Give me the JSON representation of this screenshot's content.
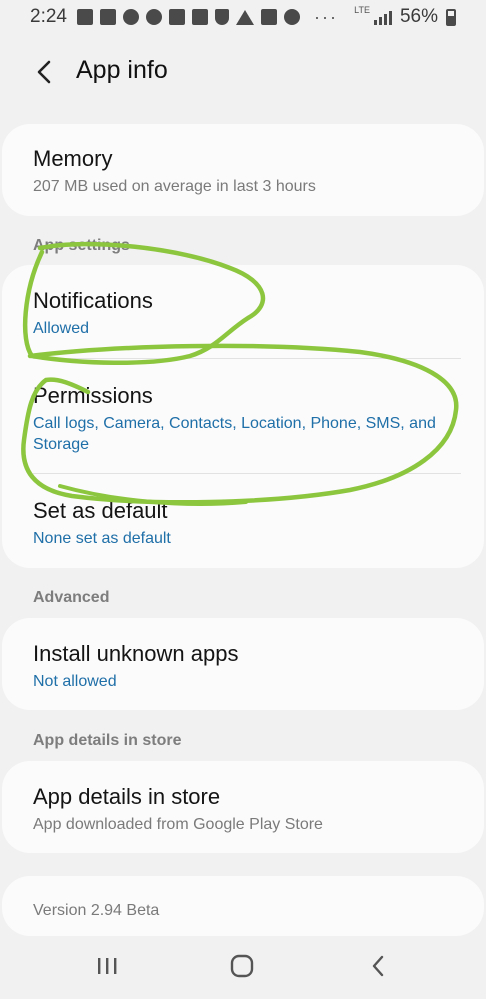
{
  "status_bar": {
    "time": "2:24",
    "dots": "···",
    "network": "LTE",
    "battery": "56%",
    "icons": [
      "facebook-icon",
      "video-camera-icon",
      "tiktok-icon",
      "tiktok-icon",
      "message-icon",
      "shopping-bag-icon",
      "shield-icon",
      "drive-icon",
      "facebook-icon",
      "tv-icon"
    ]
  },
  "header": {
    "title": "App info"
  },
  "memory": {
    "title": "Memory",
    "subtitle": "207 MB used on average in last 3 hours"
  },
  "app_settings": {
    "section_label": "App settings",
    "notifications": {
      "title": "Notifications",
      "subtitle": "Allowed"
    },
    "permissions": {
      "title": "Permissions",
      "subtitle": "Call logs, Camera, Contacts, Location, Phone, SMS, and Storage"
    },
    "default": {
      "title": "Set as default",
      "subtitle": "None set as default"
    }
  },
  "advanced": {
    "section_label": "Advanced",
    "install_unknown": {
      "title": "Install unknown apps",
      "subtitle": "Not allowed"
    }
  },
  "store": {
    "section_label": "App details in store",
    "details": {
      "title": "App details in store",
      "subtitle": "App downloaded from Google Play Store"
    }
  },
  "version": {
    "text": "Version 2.94 Beta"
  },
  "colors": {
    "link_blue": "#1f6fa8",
    "annotation_green": "#8cc63f",
    "background": "#f1f1f1"
  }
}
